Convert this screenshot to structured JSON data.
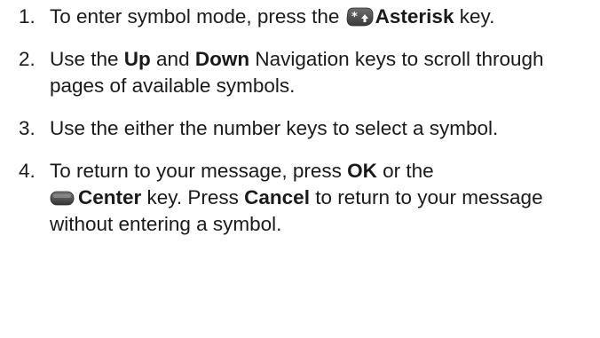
{
  "steps": [
    {
      "number": "1.",
      "t1": "To enter symbol mode, press the ",
      "icon": "asterisk-key-icon",
      "k1": "Asterisk",
      "t2": " key."
    },
    {
      "number": "2.",
      "t1": "Use the ",
      "k1": "Up",
      "t2": " and ",
      "k2": "Down",
      "t3": " Navigation keys to scroll through pages of available symbols."
    },
    {
      "number": "3.",
      "t1": "Use the either the number keys to select a symbol."
    },
    {
      "number": "4.",
      "t1": "To return to your message, press ",
      "k1": "OK",
      "t2": " or the ",
      "icon": "center-key-icon",
      "k2": "Center",
      "t3": " key. Press ",
      "k3": "Cancel",
      "t4": " to return to your message without entering a symbol."
    }
  ]
}
